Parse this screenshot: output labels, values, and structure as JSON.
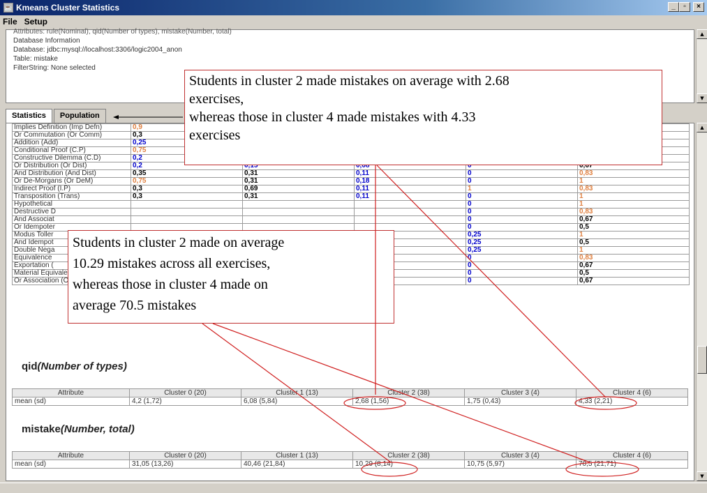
{
  "window": {
    "title": "Kmeans Cluster Statistics"
  },
  "menu": [
    "File",
    "Setup"
  ],
  "info": {
    "cut_line": "Attributes: rule(Nominal), qid(Number of types), mistake(Number, total)",
    "lines": [
      "Database Information",
      "Database: jdbc:mysql://localhost:3306/logic2004_anon",
      "Table: mistake",
      "FilterString: None selected"
    ]
  },
  "tabs": [
    "Statistics",
    "Population"
  ],
  "colors": {
    "blue": "#0000cc",
    "black": "#000000",
    "orange": "#e08040",
    "callout_border": "#c03030"
  },
  "attributes": [
    {
      "name": "Implies Definition (Imp Defn)",
      "v": [
        [
          "0,9",
          "o"
        ],
        [
          "",
          ""
        ],
        [
          "",
          ""
        ],
        [
          "",
          ""
        ],
        [
          "",
          ""
        ]
      ]
    },
    {
      "name": "Or Commutation (Or Comm)",
      "v": [
        [
          "0,3",
          "k"
        ],
        [
          "",
          ""
        ],
        [
          "",
          ""
        ],
        [
          "",
          ""
        ],
        [
          "",
          ""
        ]
      ]
    },
    {
      "name": "Addition (Add)",
      "v": [
        [
          "0,25",
          "b"
        ],
        [
          "",
          ""
        ],
        [
          "",
          ""
        ],
        [
          "",
          ""
        ],
        [
          "",
          ""
        ]
      ]
    },
    {
      "name": "Conditional Proof (C.P)",
      "v": [
        [
          "0,75",
          "o"
        ],
        [
          "",
          ""
        ],
        [
          "",
          ""
        ],
        [
          "",
          ""
        ],
        [
          "",
          ""
        ]
      ]
    },
    {
      "name": "Constructive Dilemma (C.D)",
      "v": [
        [
          "0,2",
          "b"
        ],
        [
          "0,31",
          "k"
        ],
        [
          "0,11",
          "b"
        ],
        [
          "0",
          "b"
        ],
        [
          "0,83",
          "o"
        ]
      ]
    },
    {
      "name": "Or Distribution (Or Dist)",
      "v": [
        [
          "0,2",
          "b"
        ],
        [
          "0,15",
          "b"
        ],
        [
          "0,08",
          "b"
        ],
        [
          "0",
          "b"
        ],
        [
          "0,67",
          "k"
        ]
      ]
    },
    {
      "name": "And Distribution (And Dist)",
      "v": [
        [
          "0,35",
          "k"
        ],
        [
          "0,31",
          "k"
        ],
        [
          "0,11",
          "b"
        ],
        [
          "0",
          "b"
        ],
        [
          "0,83",
          "o"
        ]
      ]
    },
    {
      "name": "Or De-Morgans (Or DeM)",
      "v": [
        [
          "0,75",
          "o"
        ],
        [
          "0,31",
          "k"
        ],
        [
          "0,18",
          "b"
        ],
        [
          "0",
          "b"
        ],
        [
          "1",
          "o"
        ]
      ]
    },
    {
      "name": "Indirect Proof (I.P)",
      "v": [
        [
          "0,3",
          "k"
        ],
        [
          "0,69",
          "k"
        ],
        [
          "0,11",
          "b"
        ],
        [
          "1",
          "o"
        ],
        [
          "0,83",
          "o"
        ]
      ]
    },
    {
      "name": "Transposition (Trans)",
      "v": [
        [
          "0,3",
          "k"
        ],
        [
          "0,31",
          "k"
        ],
        [
          "0,11",
          "b"
        ],
        [
          "0",
          "b"
        ],
        [
          "1",
          "o"
        ]
      ]
    },
    {
      "name": "Hypothetical",
      "v": [
        [
          "",
          ""
        ],
        [
          "",
          ""
        ],
        [
          "",
          ""
        ],
        [
          "0",
          "b"
        ],
        [
          "1",
          "o"
        ]
      ]
    },
    {
      "name": "Destructive D",
      "v": [
        [
          "",
          ""
        ],
        [
          "",
          ""
        ],
        [
          "",
          ""
        ],
        [
          "0",
          "b"
        ],
        [
          "0,83",
          "o"
        ]
      ]
    },
    {
      "name": "And Associat",
      "v": [
        [
          "",
          ""
        ],
        [
          "",
          ""
        ],
        [
          "",
          ""
        ],
        [
          "0",
          "b"
        ],
        [
          "0,67",
          "k"
        ]
      ]
    },
    {
      "name": "Or Idempoter",
      "v": [
        [
          "",
          ""
        ],
        [
          "",
          ""
        ],
        [
          "",
          ""
        ],
        [
          "0",
          "b"
        ],
        [
          "0,5",
          "k"
        ]
      ]
    },
    {
      "name": "Modus Toller",
      "v": [
        [
          "",
          ""
        ],
        [
          "",
          ""
        ],
        [
          "",
          ""
        ],
        [
          "0,25",
          "b"
        ],
        [
          "1",
          "o"
        ]
      ]
    },
    {
      "name": "And Idempot",
      "v": [
        [
          "",
          ""
        ],
        [
          "",
          ""
        ],
        [
          "",
          ""
        ],
        [
          "0,25",
          "b"
        ],
        [
          "0,5",
          "k"
        ]
      ]
    },
    {
      "name": "Double Nega",
      "v": [
        [
          "",
          ""
        ],
        [
          "",
          ""
        ],
        [
          "",
          ""
        ],
        [
          "0,25",
          "b"
        ],
        [
          "1",
          "o"
        ]
      ]
    },
    {
      "name": "Equivalence",
      "v": [
        [
          "",
          ""
        ],
        [
          "",
          ""
        ],
        [
          "",
          ""
        ],
        [
          "0",
          "b"
        ],
        [
          "0,83",
          "o"
        ]
      ]
    },
    {
      "name": "Exportation (",
      "v": [
        [
          "",
          ""
        ],
        [
          "",
          ""
        ],
        [
          "",
          ""
        ],
        [
          "0",
          "b"
        ],
        [
          "0,67",
          "k"
        ]
      ]
    },
    {
      "name": "Material Equivalence (Equiv)",
      "v": [
        [
          "0,1",
          "b"
        ],
        [
          "0,15",
          "b"
        ],
        [
          "0,08",
          "b"
        ],
        [
          "0",
          "b"
        ],
        [
          "0,5",
          "k"
        ]
      ]
    },
    {
      "name": "Or Association (Or Assoc)",
      "v": [
        [
          "0",
          "b"
        ],
        [
          "0",
          "b"
        ],
        [
          "0,03",
          "b"
        ],
        [
          "0",
          "b"
        ],
        [
          "0,67",
          "k"
        ]
      ]
    }
  ],
  "qid": {
    "heading": "qid",
    "heading_sub": "(Number of types)",
    "headers": [
      "Attribute",
      "Cluster 0 (20)",
      "Cluster 1 (13)",
      "Cluster 2 (38)",
      "Cluster 3 (4)",
      "Cluster 4 (6)"
    ],
    "row": [
      "mean (sd)",
      "4,2 (1,72)",
      "6,08 (5,84)",
      "2,68 (1,56)",
      "1,75 (0,43)",
      "4,33 (2,21)"
    ]
  },
  "mistake": {
    "heading": "mistake",
    "heading_sub": "(Number, total)",
    "headers": [
      "Attribute",
      "Cluster 0 (20)",
      "Cluster 1 (13)",
      "Cluster 2 (38)",
      "Cluster 3 (4)",
      "Cluster 4 (6)"
    ],
    "row": [
      "mean (sd)",
      "31,05 (13,26)",
      "40,46 (21,84)",
      "10,29 (8,14)",
      "10,75 (5,97)",
      "70,5 (21,71)"
    ]
  },
  "callouts": {
    "top": [
      "Students in cluster 2 made mistakes on average with 2.68",
      "exercises,",
      "whereas those in cluster 4 made mistakes with 4.33",
      "exercises"
    ],
    "mid": [
      "Students in cluster 2 made on average",
      "10.29 mistakes across all exercises,",
      "whereas those in cluster 4 made on",
      "average 70.5 mistakes"
    ]
  }
}
